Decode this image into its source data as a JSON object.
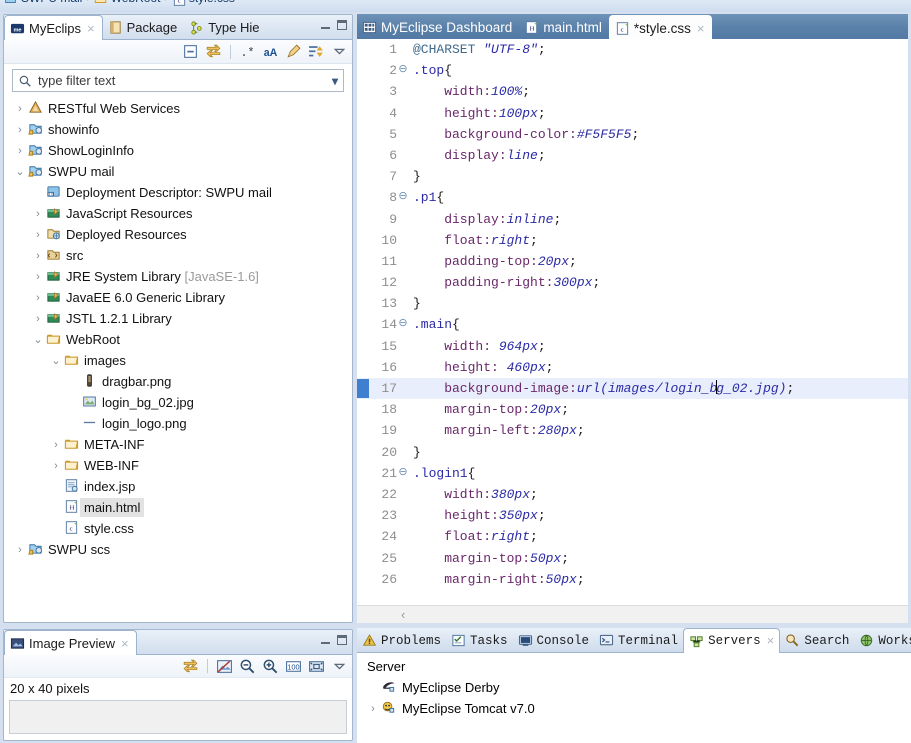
{
  "breadcrumb": {
    "items": [
      "SWPU mail",
      "WebRoot",
      "style.css"
    ],
    "separator": "›"
  },
  "explorer": {
    "tabs": [
      {
        "label": "MyEclips",
        "icon": "myeclipse-icon",
        "active": true,
        "closable": true
      },
      {
        "label": "Package",
        "icon": "package-explorer-icon",
        "active": false,
        "closable": false
      },
      {
        "label": "Type Hie",
        "icon": "type-hierarchy-icon",
        "active": false,
        "closable": false
      }
    ],
    "chrome": {
      "minimize": "minimize-button",
      "maximize": "maximize-button"
    },
    "toolbar": [
      "collapse-all-icon",
      "link-with-editor-icon",
      "regex-filter-icon",
      "case-sensitive-icon",
      "focus-on-active-task-icon",
      "sort-icon",
      "view-menu-icon"
    ],
    "filter": {
      "placeholder": "type filter text",
      "value": ""
    },
    "tree": [
      {
        "indent": 0,
        "twisty": "›",
        "icon": "restful-icon",
        "label": "RESTful Web Services",
        "selected": false
      },
      {
        "indent": 0,
        "twisty": "›",
        "icon": "project-icon",
        "label": "showinfo",
        "selected": false
      },
      {
        "indent": 0,
        "twisty": "›",
        "icon": "project-icon",
        "label": "ShowLoginInfo",
        "selected": false
      },
      {
        "indent": 0,
        "twisty": "⌄",
        "icon": "project-icon",
        "label": "SWPU mail",
        "selected": false
      },
      {
        "indent": 1,
        "twisty": "",
        "icon": "deployment-descriptor-icon",
        "label": "Deployment Descriptor: SWPU mail",
        "selected": false
      },
      {
        "indent": 1,
        "twisty": "›",
        "icon": "library-icon",
        "label": "JavaScript Resources",
        "selected": false
      },
      {
        "indent": 1,
        "twisty": "›",
        "icon": "deployed-resources-icon",
        "label": "Deployed Resources",
        "selected": false
      },
      {
        "indent": 1,
        "twisty": "›",
        "icon": "source-folder-icon",
        "label": "src",
        "selected": false
      },
      {
        "indent": 1,
        "twisty": "›",
        "icon": "library-icon",
        "label": "JRE System Library",
        "suffix": "[JavaSE-1.6]",
        "selected": false
      },
      {
        "indent": 1,
        "twisty": "›",
        "icon": "library-icon",
        "label": "JavaEE 6.0 Generic Library",
        "selected": false
      },
      {
        "indent": 1,
        "twisty": "›",
        "icon": "library-icon",
        "label": "JSTL 1.2.1 Library",
        "selected": false
      },
      {
        "indent": 1,
        "twisty": "⌄",
        "icon": "folder-icon",
        "label": "WebRoot",
        "selected": false
      },
      {
        "indent": 2,
        "twisty": "⌄",
        "icon": "folder-icon",
        "label": "images",
        "selected": false
      },
      {
        "indent": 3,
        "twisty": "",
        "icon": "png-file-icon",
        "label": "dragbar.png",
        "selected": false
      },
      {
        "indent": 3,
        "twisty": "",
        "icon": "jpg-file-icon",
        "label": "login_bg_02.jpg",
        "selected": false
      },
      {
        "indent": 3,
        "twisty": "",
        "icon": "line-file-icon",
        "label": "login_logo.png",
        "selected": false
      },
      {
        "indent": 2,
        "twisty": "›",
        "icon": "folder-icon",
        "label": "META-INF",
        "selected": false
      },
      {
        "indent": 2,
        "twisty": "›",
        "icon": "folder-icon",
        "label": "WEB-INF",
        "selected": false
      },
      {
        "indent": 2,
        "twisty": "",
        "icon": "jsp-file-icon",
        "label": "index.jsp",
        "selected": false
      },
      {
        "indent": 2,
        "twisty": "",
        "icon": "html-file-icon",
        "label": "main.html",
        "selected": true
      },
      {
        "indent": 2,
        "twisty": "",
        "icon": "css-file-icon",
        "label": "style.css",
        "selected": false
      },
      {
        "indent": 0,
        "twisty": "›",
        "icon": "project-icon",
        "label": "SWPU scs",
        "selected": false
      }
    ]
  },
  "image_preview": {
    "tabs": [
      {
        "label": "Image Preview",
        "icon": "image-preview-icon",
        "active": true,
        "closable": true
      }
    ],
    "chrome": {
      "minimize": "minimize-button",
      "maximize": "maximize-button"
    },
    "toolbar": [
      "link-with-editor-icon",
      "restore-original-size-icon",
      "zoom-out-icon",
      "zoom-in-icon",
      "actual-size-icon",
      "fit-to-window-icon",
      "view-menu-icon"
    ],
    "dimensions": "20 x 40 pixels"
  },
  "editor": {
    "tabs": [
      {
        "label": "MyEclipse Dashboard",
        "icon": "dashboard-icon",
        "active": false,
        "closable": false
      },
      {
        "label": "main.html",
        "icon": "html-file-icon",
        "active": false,
        "closable": false
      },
      {
        "label": "*style.css",
        "icon": "css-file-icon",
        "active": true,
        "closable": true
      }
    ],
    "current_line": 17,
    "scroll_arrow": "‹",
    "lines": [
      {
        "n": 1,
        "fold": "",
        "tokens": [
          {
            "t": "@CHARSET ",
            "c": "atrule"
          },
          {
            "t": "\"UTF-8\"",
            "c": "str"
          },
          {
            "t": ";",
            "c": "punc"
          }
        ]
      },
      {
        "n": 2,
        "fold": "⊖",
        "tokens": [
          {
            "t": ".top",
            "c": "sel"
          },
          {
            "t": "{",
            "c": "punc"
          }
        ]
      },
      {
        "n": 3,
        "fold": "",
        "tokens": [
          {
            "t": "    width:",
            "c": "prop"
          },
          {
            "t": "100%",
            "c": "val"
          },
          {
            "t": ";",
            "c": "punc"
          }
        ]
      },
      {
        "n": 4,
        "fold": "",
        "tokens": [
          {
            "t": "    height:",
            "c": "prop"
          },
          {
            "t": "100px",
            "c": "val"
          },
          {
            "t": ";",
            "c": "punc"
          }
        ]
      },
      {
        "n": 5,
        "fold": "",
        "tokens": [
          {
            "t": "    background-color:",
            "c": "prop"
          },
          {
            "t": "#F5F5F5",
            "c": "val"
          },
          {
            "t": ";",
            "c": "punc"
          }
        ]
      },
      {
        "n": 6,
        "fold": "",
        "tokens": [
          {
            "t": "    display:",
            "c": "prop"
          },
          {
            "t": "line",
            "c": "val"
          },
          {
            "t": ";",
            "c": "punc"
          }
        ]
      },
      {
        "n": 7,
        "fold": "",
        "tokens": [
          {
            "t": "}",
            "c": "punc"
          }
        ]
      },
      {
        "n": 8,
        "fold": "⊖",
        "tokens": [
          {
            "t": ".p1",
            "c": "sel"
          },
          {
            "t": "{",
            "c": "punc"
          }
        ]
      },
      {
        "n": 9,
        "fold": "",
        "tokens": [
          {
            "t": "    display:",
            "c": "prop"
          },
          {
            "t": "inline",
            "c": "val"
          },
          {
            "t": ";",
            "c": "punc"
          }
        ]
      },
      {
        "n": 10,
        "fold": "",
        "tokens": [
          {
            "t": "    float:",
            "c": "prop"
          },
          {
            "t": "right",
            "c": "val"
          },
          {
            "t": ";",
            "c": "punc"
          }
        ]
      },
      {
        "n": 11,
        "fold": "",
        "tokens": [
          {
            "t": "    padding-top:",
            "c": "prop"
          },
          {
            "t": "20px",
            "c": "val"
          },
          {
            "t": ";",
            "c": "punc"
          }
        ]
      },
      {
        "n": 12,
        "fold": "",
        "tokens": [
          {
            "t": "    padding-right:",
            "c": "prop"
          },
          {
            "t": "300px",
            "c": "val"
          },
          {
            "t": ";",
            "c": "punc"
          }
        ]
      },
      {
        "n": 13,
        "fold": "",
        "tokens": [
          {
            "t": "}",
            "c": "punc"
          }
        ]
      },
      {
        "n": 14,
        "fold": "⊖",
        "tokens": [
          {
            "t": ".main",
            "c": "sel"
          },
          {
            "t": "{",
            "c": "punc"
          }
        ]
      },
      {
        "n": 15,
        "fold": "",
        "tokens": [
          {
            "t": "    width:",
            "c": "prop"
          },
          {
            "t": " 964px",
            "c": "val"
          },
          {
            "t": ";",
            "c": "punc"
          }
        ]
      },
      {
        "n": 16,
        "fold": "",
        "tokens": [
          {
            "t": "    height:",
            "c": "prop"
          },
          {
            "t": " 460px",
            "c": "val"
          },
          {
            "t": ";",
            "c": "punc"
          }
        ]
      },
      {
        "n": 17,
        "fold": "",
        "tokens": [
          {
            "t": "    background-image:",
            "c": "prop"
          },
          {
            "t": "url(images/login_b",
            "c": "val"
          },
          {
            "t": "|",
            "c": "caret"
          },
          {
            "t": "g_02.jpg)",
            "c": "val"
          },
          {
            "t": ";",
            "c": "punc"
          }
        ]
      },
      {
        "n": 18,
        "fold": "",
        "tokens": [
          {
            "t": "    margin-top:",
            "c": "prop"
          },
          {
            "t": "20px",
            "c": "val"
          },
          {
            "t": ";",
            "c": "punc"
          }
        ]
      },
      {
        "n": 19,
        "fold": "",
        "tokens": [
          {
            "t": "    margin-left:",
            "c": "prop"
          },
          {
            "t": "280px",
            "c": "val"
          },
          {
            "t": ";",
            "c": "punc"
          }
        ]
      },
      {
        "n": 20,
        "fold": "",
        "tokens": [
          {
            "t": "}",
            "c": "punc"
          }
        ]
      },
      {
        "n": 21,
        "fold": "⊖",
        "tokens": [
          {
            "t": ".login1",
            "c": "sel"
          },
          {
            "t": "{",
            "c": "punc"
          }
        ]
      },
      {
        "n": 22,
        "fold": "",
        "tokens": [
          {
            "t": "    width:",
            "c": "prop"
          },
          {
            "t": "380px",
            "c": "val"
          },
          {
            "t": ";",
            "c": "punc"
          }
        ]
      },
      {
        "n": 23,
        "fold": "",
        "tokens": [
          {
            "t": "    height:",
            "c": "prop"
          },
          {
            "t": "350px",
            "c": "val"
          },
          {
            "t": ";",
            "c": "punc"
          }
        ]
      },
      {
        "n": 24,
        "fold": "",
        "tokens": [
          {
            "t": "    float:",
            "c": "prop"
          },
          {
            "t": "right",
            "c": "val"
          },
          {
            "t": ";",
            "c": "punc"
          }
        ]
      },
      {
        "n": 25,
        "fold": "",
        "tokens": [
          {
            "t": "    margin-top:",
            "c": "prop"
          },
          {
            "t": "50px",
            "c": "val"
          },
          {
            "t": ";",
            "c": "punc"
          }
        ]
      },
      {
        "n": 26,
        "fold": "",
        "tokens": [
          {
            "t": "    margin-right:",
            "c": "prop"
          },
          {
            "t": "50px",
            "c": "val"
          },
          {
            "t": ";",
            "c": "punc"
          }
        ]
      }
    ]
  },
  "bottom_panel": {
    "tabs": [
      {
        "label": "Problems",
        "icon": "problems-icon",
        "active": false,
        "closable": false
      },
      {
        "label": "Tasks",
        "icon": "tasks-icon",
        "active": false,
        "closable": false
      },
      {
        "label": "Console",
        "icon": "console-icon",
        "active": false,
        "closable": false
      },
      {
        "label": "Terminal",
        "icon": "terminal-icon",
        "active": false,
        "closable": false
      },
      {
        "label": "Servers",
        "icon": "servers-icon",
        "active": true,
        "closable": true
      },
      {
        "label": "Search",
        "icon": "search-icon",
        "active": false,
        "closable": false
      },
      {
        "label": "Worksp",
        "icon": "workspace-icon",
        "active": false,
        "closable": false
      }
    ],
    "column_header": "Server",
    "rows": [
      {
        "twisty": "",
        "icon": "derby-server-icon",
        "label": "MyEclipse Derby"
      },
      {
        "twisty": "›",
        "icon": "tomcat-server-icon",
        "label": "MyEclipse Tomcat v7.0"
      }
    ]
  },
  "colors": {
    "tab_active_editor": "#5a81aa",
    "selection_gray": "#e2e2e2",
    "current_line": "#e8eefb",
    "cursor_marker": "#3f7fd0",
    "selector_blue": "#2a2aa5",
    "property_purple": "#6a276a"
  }
}
